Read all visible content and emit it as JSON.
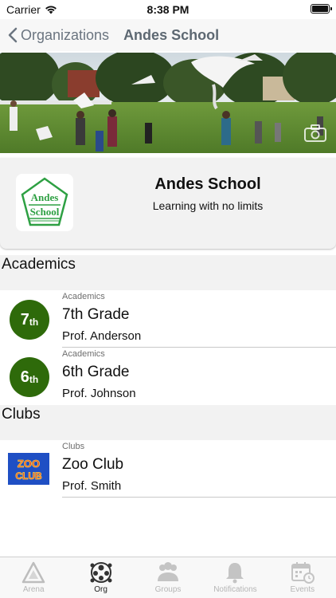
{
  "status_bar": {
    "carrier": "Carrier",
    "time": "8:38 PM"
  },
  "nav": {
    "back_label": "Organizations",
    "title": "Andes School"
  },
  "org": {
    "name": "Andes School",
    "tagline": "Learning with no limits",
    "logo_line1": "Andes",
    "logo_line2": "School"
  },
  "sections": [
    {
      "header": "Academics",
      "rows": [
        {
          "category": "Academics",
          "badge_num": "7",
          "badge_suffix": "th",
          "title": "7th Grade",
          "subtitle": "Prof. Anderson"
        },
        {
          "category": "Academics",
          "badge_num": "6",
          "badge_suffix": "th",
          "title": "6th Grade",
          "subtitle": "Prof. Johnson"
        }
      ]
    },
    {
      "header": "Clubs",
      "rows": [
        {
          "category": "Clubs",
          "image_text_1": "ZOO",
          "image_text_2": "CLUB",
          "title": "Zoo Club",
          "subtitle": "Prof. Smith"
        }
      ]
    }
  ],
  "tabs": [
    {
      "label": "Arena",
      "icon": "arena-icon",
      "active": false
    },
    {
      "label": "Org",
      "icon": "org-icon",
      "active": true
    },
    {
      "label": "Groups",
      "icon": "groups-icon",
      "active": false
    },
    {
      "label": "Notifications",
      "icon": "bell-icon",
      "active": false
    },
    {
      "label": "Events",
      "icon": "calendar-icon",
      "active": false
    }
  ],
  "colors": {
    "badge_green": "#2e6a0a",
    "nav_text": "#5d6872",
    "logo_green": "#2ea043",
    "section_bg": "#f2f2f2"
  }
}
